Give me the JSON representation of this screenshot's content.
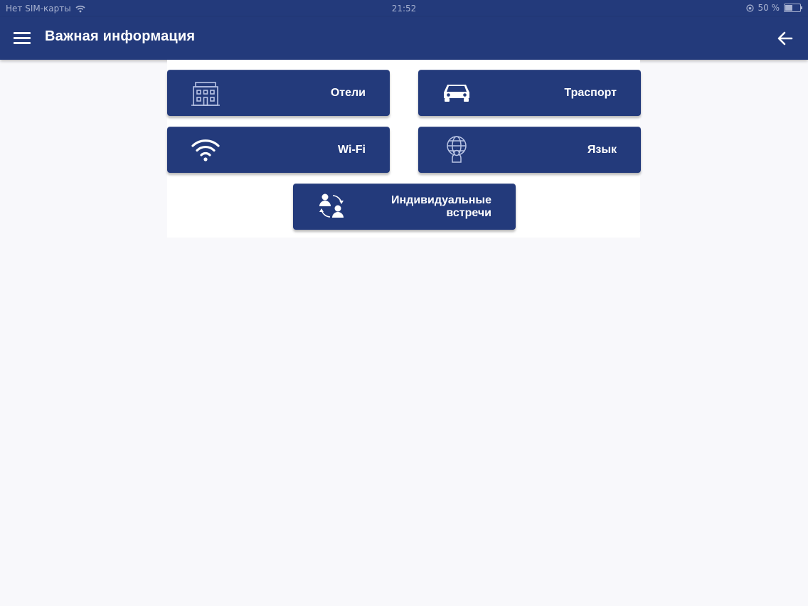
{
  "status_bar": {
    "carrier": "Нет SIM-карты",
    "time": "21:52",
    "battery": "50 %",
    "battery_level": 0.5
  },
  "app_bar": {
    "title": "Важная информация",
    "menu_icon": "hamburger-menu-icon",
    "back_icon": "arrow-left-icon"
  },
  "tiles": [
    {
      "label": "Отели",
      "icon": "hotel-icon"
    },
    {
      "label": "Траспорт",
      "icon": "car-icon"
    },
    {
      "label": "Wi-Fi",
      "icon": "wifi-icon"
    },
    {
      "label": "Язык",
      "icon": "globe-person-icon"
    },
    {
      "label": "Индивидуальные встречи",
      "icon": "meeting-people-icon"
    }
  ],
  "colors": {
    "primary": "#233a7b",
    "background": "#f8f8fb",
    "on_primary": "#ffffff"
  }
}
